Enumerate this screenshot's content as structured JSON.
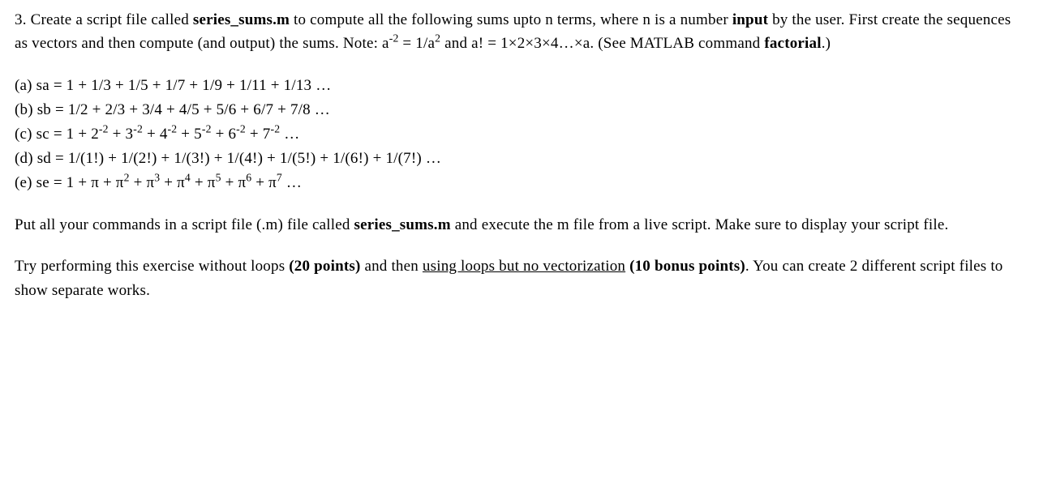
{
  "intro": {
    "t1": "3. Create a script file called ",
    "fname": "series_sums.m",
    "t2": " to compute all the following  sums upto n terms, where n is a number ",
    "input_word": "input",
    "t3": " by the user. First create the sequences as vectors and then compute (and output) the sums. Note: a",
    "sup1": "-2",
    "t4": " = 1/a",
    "sup2": "2",
    "t5": " and a! = 1×2×3×4…×a.  (See MATLAB command ",
    "fact_word": "factorial",
    "t6": ".)"
  },
  "series": {
    "a": "(a) sa = 1 + 1/3 + 1/5 + 1/7 + 1/9 + 1/11 + 1/13 …",
    "b": "(b) sb = 1/2 +  2/3 +  3/4 + 4/5 + 5/6 + 6/7 + 7/8 …",
    "c_pre": "(c) sc = 1 + 2",
    "c_mid": " + 3",
    "c_mid2": " + 4",
    "c_mid3": " + 5",
    "c_mid4": " + 6",
    "c_mid5": " + 7",
    "c_exp": "-2",
    "c_end": "  …",
    "d": "(d) sd = 1/(1!) + 1/(2!) + 1/(3!) + 1/(4!) + 1/(5!) + 1/(6!) + 1/(7!)  …",
    "e_pre": "(e) se = 1 + π + π",
    "e_e2": "2",
    "e_mid": " + π",
    "e_e3": "3",
    "e_e4": "4",
    "e_e5": "5",
    "e_e6": "6",
    "e_e7": "7",
    "e_end": " …"
  },
  "para2": {
    "t1": "Put all your commands in a script file (.m) file called ",
    "fname": "series_sums.m",
    "t2": " and execute the m file from a live script. Make sure to display your script file."
  },
  "para3": {
    "t1": "Try performing this exercise without loops ",
    "pts1": "(20 points)",
    "t2": " and then ",
    "under": "using  loops  but  no  vectorization",
    "t3": " ",
    "pts2": "(10 bonus points)",
    "t4": ". You can create 2 different script files to show separate works."
  }
}
